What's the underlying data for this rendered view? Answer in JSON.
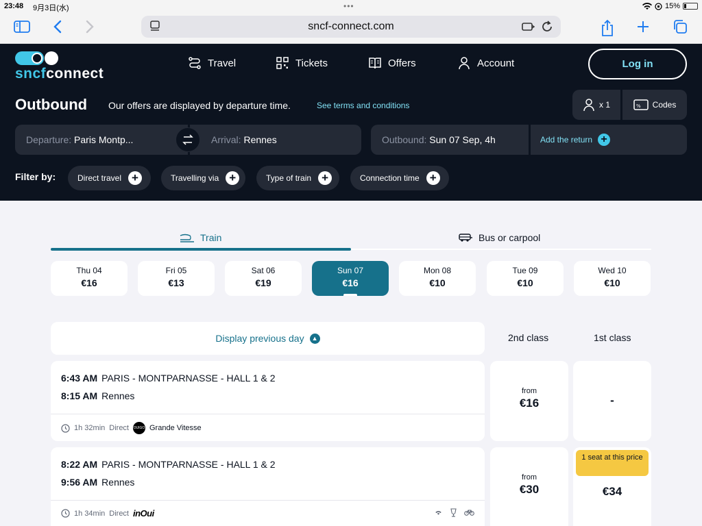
{
  "status": {
    "time": "23:48",
    "date": "9月3日(水)",
    "battery": "15%"
  },
  "browser": {
    "url": "sncf-connect.com"
  },
  "header": {
    "logo": "sncfconnect",
    "nav": [
      {
        "label": "Travel",
        "icon": "route-icon"
      },
      {
        "label": "Tickets",
        "icon": "qr-code-icon"
      },
      {
        "label": "Offers",
        "icon": "book-icon"
      },
      {
        "label": "Account",
        "icon": "person-icon"
      }
    ],
    "login": "Log in",
    "title": "Outbound",
    "note": "Our offers are displayed by departure time.",
    "terms": "See terms and conditions",
    "passengers": "x 1",
    "codes": "Codes",
    "departure_label": "Departure:",
    "departure_value": "Paris Montp...",
    "arrival_label": "Arrival:",
    "arrival_value": "Rennes",
    "outbound_label": "Outbound:",
    "outbound_value": "Sun 07 Sep, 4h",
    "add_return": "Add the return",
    "filter_label": "Filter by:",
    "filters": [
      "Direct travel",
      "Travelling via",
      "Type of train",
      "Connection time"
    ]
  },
  "modes": {
    "train": "Train",
    "bus": "Bus or carpool",
    "selected": "Train"
  },
  "days": [
    {
      "day": "Thu 04",
      "price": "€16"
    },
    {
      "day": "Fri 05",
      "price": "€13"
    },
    {
      "day": "Sat 06",
      "price": "€19"
    },
    {
      "day": "Sun 07",
      "price": "€16",
      "selected": true
    },
    {
      "day": "Mon 08",
      "price": "€10"
    },
    {
      "day": "Tue 09",
      "price": "€10"
    },
    {
      "day": "Wed 10",
      "price": "€10"
    }
  ],
  "results": {
    "prev_day": "Display previous day",
    "class2": "2nd class",
    "class1": "1st class",
    "journeys": [
      {
        "dep_time": "6:43 AM",
        "dep_station": "PARIS - MONTPARNASSE - HALL 1 & 2",
        "arr_time": "8:15 AM",
        "arr_station": "Rennes",
        "duration": "1h 32min",
        "type": "Direct",
        "operator": "Grande Vitesse",
        "operator_logo": "OUIGO",
        "second_from": "from",
        "second_price": "€16",
        "first_price": "-"
      },
      {
        "dep_time": "8:22 AM",
        "dep_station": "PARIS - MONTPARNASSE - HALL 1 & 2",
        "arr_time": "9:56 AM",
        "arr_station": "Rennes",
        "duration": "1h 34min",
        "type": "Direct",
        "operator_logo": "inOui",
        "second_from": "from",
        "second_price": "€30",
        "first_badge": "1 seat at this price",
        "first_price": "€34"
      }
    ]
  }
}
